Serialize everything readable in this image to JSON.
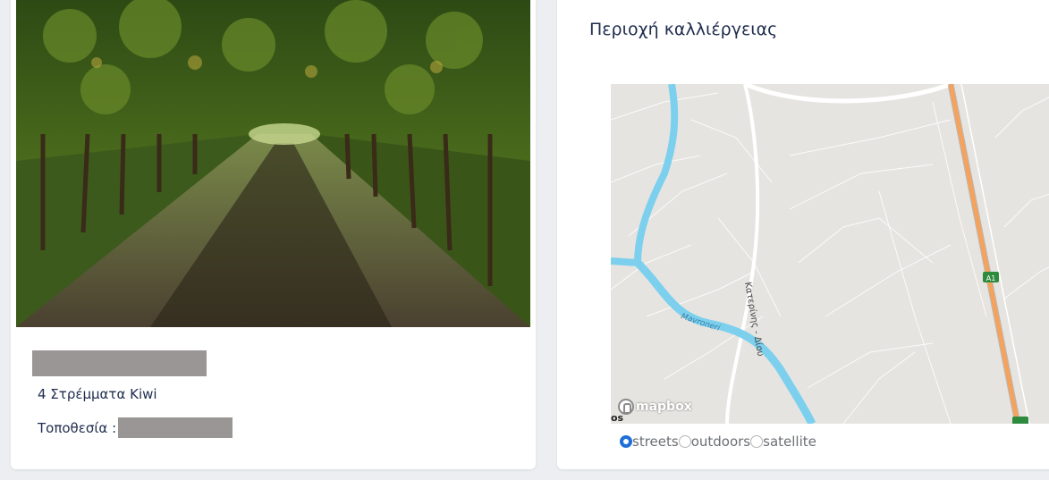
{
  "listing": {
    "photo_alt": "kiwi orchard",
    "description": "4 Στρέμματα Kiwi",
    "location_label": "Τοποθεσία :"
  },
  "map_section": {
    "title": "Περιοχή καλλιέργειας",
    "road_label": "Κατερίνης - Δίου",
    "river_label": "Mavroneri",
    "highway_badge": "A1",
    "attribution": "mapbox",
    "corner_text": "os",
    "styles": [
      {
        "label": "streets",
        "selected": true
      },
      {
        "label": "outdoors",
        "selected": false
      },
      {
        "label": "satellite",
        "selected": false
      }
    ]
  },
  "colors": {
    "heading": "#1f2d4d",
    "radio_accent": "#1e6fd9",
    "river": "#7cd0ee",
    "highway": "#f5a25d",
    "redaction": "#9b9696"
  }
}
